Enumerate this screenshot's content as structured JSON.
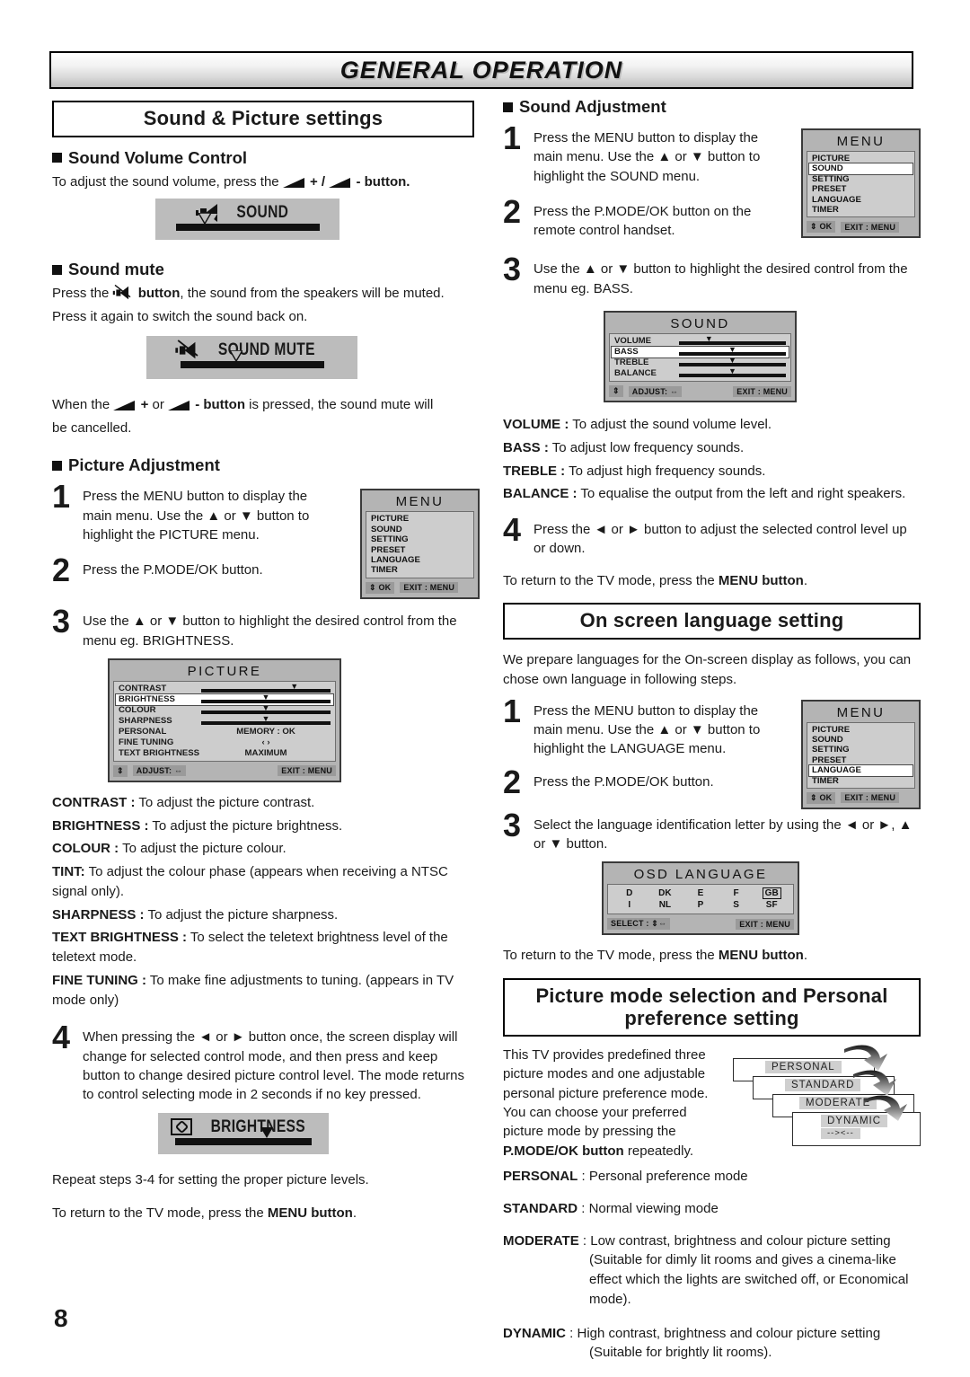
{
  "page": {
    "header_title": "GENERAL OPERATION",
    "number": "8"
  },
  "left_column": {
    "section_title": "Sound & Picture settings",
    "sound_volume": {
      "heading": "Sound Volume Control",
      "text_a": "To adjust the sound volume, press the",
      "text_plus": "+ /",
      "text_minus": "-",
      "text_b": "button.",
      "osd_label": "SOUND"
    },
    "sound_mute": {
      "heading": "Sound mute",
      "line1_a": "Press the",
      "line1_b": "button",
      "line1_c": ", the sound from the speakers will be muted.",
      "line2": "Press it again to switch the sound back on.",
      "osd_label": "SOUND MUTE",
      "after_a": "When the",
      "after_plus": "+",
      "after_or": "or",
      "after_minus": "-",
      "after_b": "button",
      "after_c": "is pressed, the sound mute will",
      "after_d": "be cancelled."
    },
    "picture_adjustment": {
      "heading": "Picture Adjustment",
      "steps": [
        {
          "num": "1",
          "text": "Press the MENU button to display the main menu. Use the ▲ or ▼ button to highlight the PICTURE menu."
        },
        {
          "num": "2",
          "text": "Press the P.MODE/OK button."
        },
        {
          "num": "3",
          "text": "Use the ▲ or ▼ button to highlight the desired control from the menu eg. BRIGHTNESS."
        },
        {
          "num": "4",
          "text": "When pressing the ◄ or ► button once, the screen display will change for selected control mode, and then press and keep button to change desired picture control level. The mode returns to control selecting mode in 2 seconds if no key pressed."
        }
      ],
      "menu_osd": {
        "title": "MENU",
        "items": [
          "PICTURE",
          "SOUND",
          "SETTING",
          "PRESET",
          "LANGUAGE",
          "TIMER"
        ],
        "selected": "PICTURE",
        "foot_keys": [
          "⇕ OK",
          "EXIT : MENU"
        ]
      },
      "picture_osd": {
        "title": "PICTURE",
        "rows": [
          {
            "name": "CONTRAST",
            "type": "slider",
            "pos": 72
          },
          {
            "name": "BRIGHTNESS",
            "type": "slider",
            "pos": 50
          },
          {
            "name": "COLOUR",
            "type": "slider",
            "pos": 50
          },
          {
            "name": "SHARPNESS",
            "type": "slider",
            "pos": 50
          },
          {
            "name": "PERSONAL",
            "type": "value",
            "value": "MEMORY : OK"
          },
          {
            "name": "FINE TUNING",
            "type": "value",
            "value": "‹  ›"
          },
          {
            "name": "TEXT BRIGHTNESS",
            "type": "value",
            "value": "MAXIMUM"
          }
        ],
        "selected": "BRIGHTNESS",
        "foot_keys": [
          "⇕",
          "ADJUST: ⇔",
          "EXIT : MENU"
        ]
      },
      "brightness_osd_label": "BRIGHTNESS",
      "descriptions": [
        {
          "term": "CONTRAST :",
          "desc": "To adjust the picture contrast."
        },
        {
          "term": "BRIGHTNESS :",
          "desc": "To adjust the picture brightness."
        },
        {
          "term": "COLOUR :",
          "desc": "To adjust the picture colour."
        },
        {
          "term": "TINT:",
          "desc": "To adjust the colour phase (appears when receiving a NTSC signal only)."
        },
        {
          "term": "SHARPNESS :",
          "desc": "To adjust the picture sharpness."
        },
        {
          "term": "TEXT BRIGHTNESS :",
          "desc": "To select the teletext brightness level of the teletext mode."
        },
        {
          "term": "FINE TUNING :",
          "desc": "To make fine adjustments to tuning. (appears in TV mode only)"
        }
      ],
      "closing_1": "Repeat steps 3-4 for setting the proper picture levels.",
      "closing_2a": "To return to the TV mode, press the",
      "closing_2b": "MENU button",
      "closing_2c": "."
    }
  },
  "right_column": {
    "sound_adjustment": {
      "heading": "Sound Adjustment",
      "steps": [
        {
          "num": "1",
          "text": "Press the MENU button to display the main menu. Use the ▲ or ▼ button to highlight the SOUND menu."
        },
        {
          "num": "2",
          "text": "Press the P.MODE/OK button on the remote control handset."
        },
        {
          "num": "3",
          "text": "Use the ▲ or ▼ button to highlight the desired control from the menu eg. BASS."
        },
        {
          "num": "4",
          "text": "Press the ◄ or ► button to adjust the selected control level up or down."
        }
      ],
      "menu_osd": {
        "title": "MENU",
        "items": [
          "PICTURE",
          "SOUND",
          "SETTING",
          "PRESET",
          "LANGUAGE",
          "TIMER"
        ],
        "selected": "SOUND",
        "foot_keys": [
          "⇕ OK",
          "EXIT : MENU"
        ]
      },
      "sound_osd": {
        "title": "SOUND",
        "rows": [
          {
            "name": "VOLUME",
            "pos": 28
          },
          {
            "name": "BASS",
            "pos": 50
          },
          {
            "name": "TREBLE",
            "pos": 50
          },
          {
            "name": "BALANCE",
            "pos": 50
          }
        ],
        "selected": "BASS",
        "foot_keys": [
          "⇕",
          "ADJUST: ⇔",
          "EXIT : MENU"
        ]
      },
      "descriptions": [
        {
          "term": "VOLUME :",
          "desc": "To adjust the sound volume level."
        },
        {
          "term": "BASS :",
          "desc": "To adjust low frequency sounds."
        },
        {
          "term": "TREBLE :",
          "desc": "To adjust high frequency sounds."
        },
        {
          "term": "BALANCE :",
          "desc": "To equalise the output from the left and right speakers."
        }
      ],
      "closing_a": "To return to the TV mode, press the",
      "closing_b": "MENU button",
      "closing_c": "."
    },
    "language_setting": {
      "section_title": "On screen language setting",
      "intro": "We prepare languages for the On-screen display as follows, you can chose own language in following steps.",
      "steps": [
        {
          "num": "1",
          "text": "Press the MENU button to display the main menu. Use the ▲ or ▼ button to highlight the LANGUAGE menu."
        },
        {
          "num": "2",
          "text": "Press the P.MODE/OK button."
        },
        {
          "num": "3",
          "text": "Select the language identification letter by using the ◄ or ►, ▲ or ▼ button."
        }
      ],
      "menu_osd": {
        "title": "MENU",
        "items": [
          "PICTURE",
          "SOUND",
          "SETTING",
          "PRESET",
          "LANGUAGE",
          "TIMER"
        ],
        "selected": "LANGUAGE",
        "foot_keys": [
          "⇕ OK",
          "EXIT : MENU"
        ]
      },
      "osd_language": {
        "title": "OSD LANGUAGE",
        "row1": [
          "D",
          "DK",
          "E",
          "F",
          "GB"
        ],
        "row2": [
          "I",
          "NL",
          "P",
          "S",
          "SF"
        ],
        "selected": "GB",
        "foot_keys": [
          "SELECT : ⇕⇔",
          "EXIT : MENU"
        ]
      },
      "closing_a": "To return to the TV mode, press the",
      "closing_b": "MENU button",
      "closing_c": "."
    },
    "picture_mode": {
      "section_title": "Picture mode selection and Personal preference setting",
      "intro_a": "This TV provides predefined three picture modes and one adjustable personal picture preference mode. You can choose your preferred picture mode by pressing the",
      "intro_b": "P.MODE/OK button",
      "intro_c": "repeatedly.",
      "cascade": {
        "items": [
          "PERSONAL",
          "STANDARD",
          "MODERATE",
          "DYNAMIC"
        ],
        "dynamic_sub": "--><--"
      },
      "descriptions": [
        {
          "term": "PERSONAL",
          "sep": ":",
          "desc": "Personal preference mode"
        },
        {
          "term": "STANDARD",
          "sep": ":",
          "desc": "Normal viewing mode"
        },
        {
          "term": "MODERATE",
          "sep": ":",
          "desc": "Low contrast, brightness and colour picture setting (Suitable for dimly lit rooms and gives a cinema-like effect which the lights are switched off, or Economical mode)."
        },
        {
          "term": "DYNAMIC",
          "sep": ":",
          "desc": "High contrast, brightness and colour picture setting (Suitable for brightly lit rooms)."
        }
      ]
    }
  }
}
